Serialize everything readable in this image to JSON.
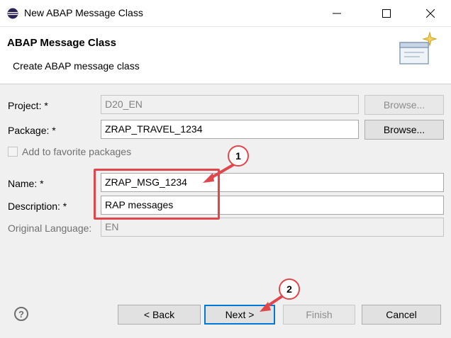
{
  "window": {
    "title": "New ABAP Message Class",
    "minimize_icon": "minimize-icon",
    "maximize_icon": "maximize-icon",
    "close_icon": "close-icon"
  },
  "header": {
    "title": "ABAP Message Class",
    "description": "Create ABAP message class"
  },
  "form": {
    "project_label": "Project: *",
    "project_value": "D20_EN",
    "package_label": "Package: *",
    "package_value": "ZRAP_TRAVEL_1234",
    "browse_label": "Browse...",
    "favorites_label": "Add to favorite packages",
    "name_label": "Name: *",
    "name_value": "ZRAP_MSG_1234",
    "description_label": "Description: *",
    "description_value": "RAP messages",
    "original_language_label": "Original Language:",
    "original_language_value": "EN"
  },
  "footer": {
    "help_symbol": "?",
    "back_label": "< Back",
    "next_label": "Next >",
    "finish_label": "Finish",
    "cancel_label": "Cancel"
  },
  "annotations": {
    "callout_1": "1",
    "callout_2": "2",
    "accent_color": "#e0474c"
  }
}
